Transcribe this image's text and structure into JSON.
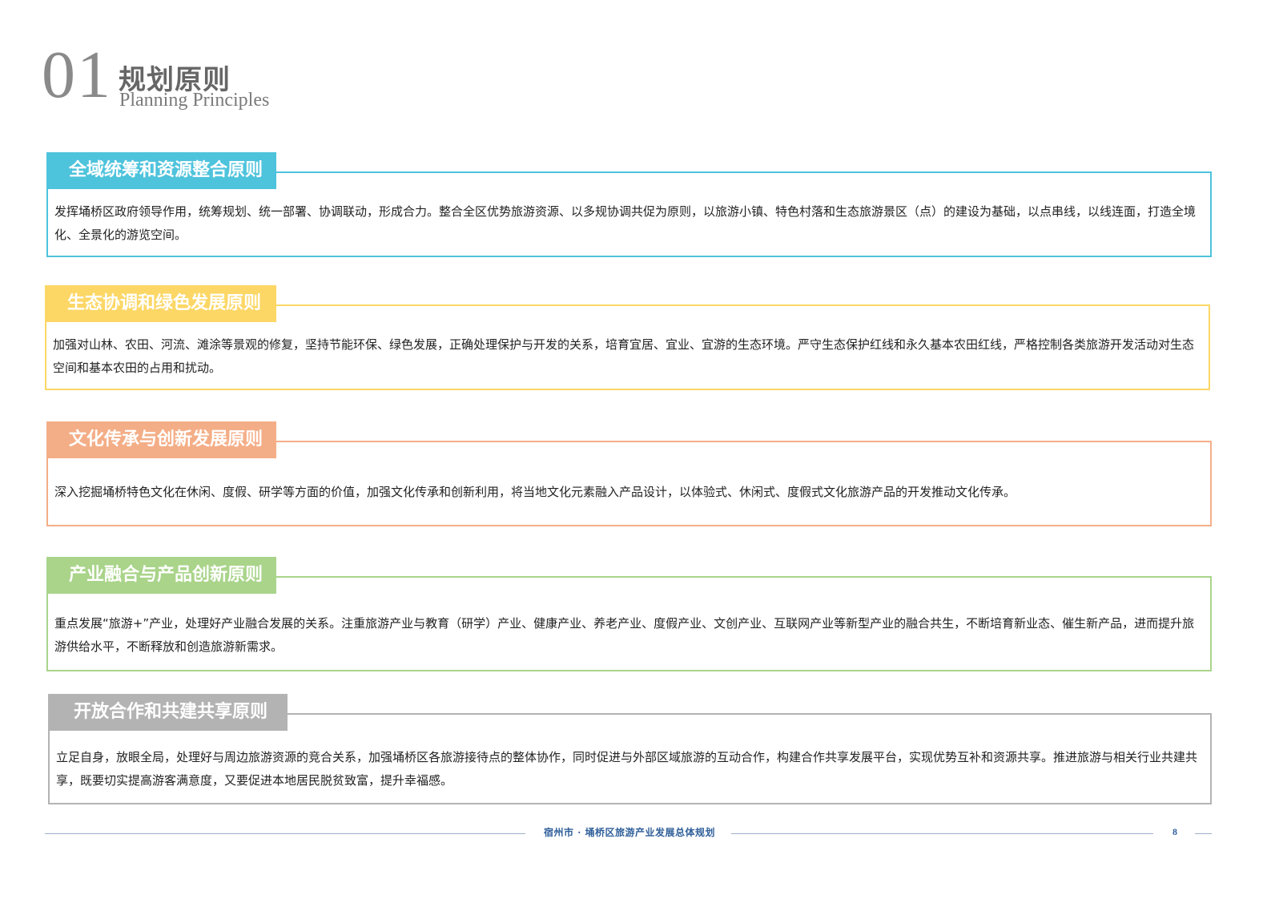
{
  "header": {
    "number": "01",
    "title": "规划原则",
    "subtitle": "Planning Principles"
  },
  "sections": [
    {
      "title": "全域统筹和资源整合原则",
      "color": "#4ec3dc",
      "text": "发挥埇桥区政府领导作用，统筹规划、统一部署、协调联动，形成合力。整合全区优势旅游资源、以多规协调共促为原则，以旅游小镇、特色村落和生态旅游景区（点）的建设为基础，以点串线，以线连面，打造全境化、全景化的游览空间。"
    },
    {
      "title": "生态协调和绿色发展原则",
      "color": "#fcd766",
      "text": "加强对山林、农田、河流、滩涂等景观的修复，坚持节能环保、绿色发展，正确处理保护与开发的关系，培育宜居、宜业、宜游的生态环境。严守生态保护红线和永久基本农田红线，严格控制各类旅游开发活动对生态空间和基本农田的占用和扰动。"
    },
    {
      "title": "文化传承与创新发展原则",
      "color": "#f4ae87",
      "text": "深入挖掘埇桥特色文化在休闲、度假、研学等方面的价值，加强文化传承和创新利用，将当地文化元素融入产品设计，以体验式、休闲式、度假式文化旅游产品的开发推动文化传承。"
    },
    {
      "title": "产业融合与产品创新原则",
      "color": "#a9d48a",
      "text": "重点发展“旅游+”产业，处理好产业融合发展的关系。注重旅游产业与教育（研学）产业、健康产业、养老产业、度假产业、文创产业、互联网产业等新型产业的融合共生，不断培育新业态、催生新产品，进而提升旅游供给水平，不断释放和创造旅游新需求。"
    },
    {
      "title": "开放合作和共建共享原则",
      "color": "#b3b3b3",
      "text": "立足自身，放眼全局，处理好与周边旅游资源的竞合关系，加强埇桥区各旅游接待点的整体协作，同时促进与外部区域旅游的互动合作，构建合作共享发展平台，实现优势互补和资源共享。推进旅游与相关行业共建共享，既要切实提高游客满意度，又要促进本地居民脱贫致富，提升幸福感。"
    }
  ],
  "footer": {
    "text": "宿州市 · 埇桥区旅游产业发展总体规划",
    "page": "8",
    "color": "#2f5f9a"
  }
}
